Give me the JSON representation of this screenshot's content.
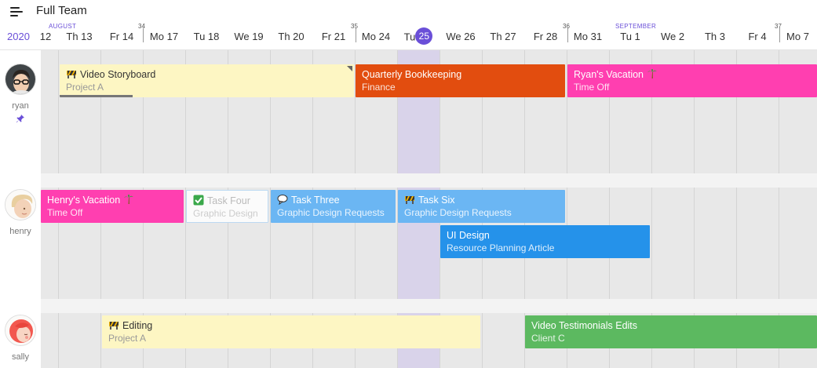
{
  "team": {
    "title": "Full Team"
  },
  "calendar": {
    "year": "2020",
    "today": "25",
    "months": [
      {
        "label": "AUGUST",
        "col": 0
      },
      {
        "label": "SEPTEMBER",
        "col": 14
      }
    ],
    "weeks": [
      {
        "num": "34",
        "col": 2
      },
      {
        "num": "35",
        "col": 7
      },
      {
        "num": "36",
        "col": 12
      },
      {
        "num": "37",
        "col": 17
      }
    ],
    "days": [
      "12",
      "Th 13",
      "Fr 14",
      "Mo 17",
      "Tu 18",
      "We 19",
      "Th 20",
      "Fr 21",
      "Mo 24",
      "Tu",
      "We 26",
      "Th 27",
      "Fr 28",
      "Mo 31",
      "Tu 1",
      "We 2",
      "Th 3",
      "Fr 4",
      "Mo 7"
    ]
  },
  "users": [
    {
      "name": "ryan",
      "pinned": true,
      "avatar": "man-glasses"
    },
    {
      "name": "henry",
      "pinned": false,
      "avatar": "boy-blond"
    },
    {
      "name": "sally",
      "pinned": false,
      "avatar": "girl-red-hair"
    }
  ],
  "tasks": [
    {
      "title": "Video Storyboard",
      "subtitle": "Project A",
      "color": "#fdf6c3",
      "icon": "construction-icon",
      "progress": 0.25
    },
    {
      "title": "Quarterly Bookkeeping",
      "subtitle": "Finance",
      "color": "#e24d0f"
    },
    {
      "title": "Ryan's Vacation",
      "subtitle": "Time Off",
      "color": "#ff3fb0",
      "icon": "palm-tree-icon"
    },
    {
      "title": "Henry's Vacation",
      "subtitle": "Time Off",
      "color": "#ff3fb0",
      "icon": "palm-tree-icon"
    },
    {
      "title": "Task Four",
      "subtitle": "Graphic Design",
      "color": "#fbfbfb",
      "icon": "check-box-icon"
    },
    {
      "title": "Task Three",
      "subtitle": "Graphic Design Requests",
      "color": "#6bb6f3",
      "icon": "speech-bubble-icon"
    },
    {
      "title": "Task Six",
      "subtitle": "Graphic Design Requests",
      "color": "#6bb6f3",
      "icon": "construction-icon"
    },
    {
      "title": "UI Design",
      "subtitle": "Resource Planning Article",
      "color": "#2592ea"
    },
    {
      "title": "Editing",
      "subtitle": "Project A",
      "color": "#fdf6c3",
      "icon": "construction-icon"
    },
    {
      "title": "Video Testimonials Edits",
      "subtitle": "Client C",
      "color": "#5cb960"
    }
  ],
  "colors": {
    "accent": "#6a4fd8",
    "today_band": "#d9d3ea"
  }
}
